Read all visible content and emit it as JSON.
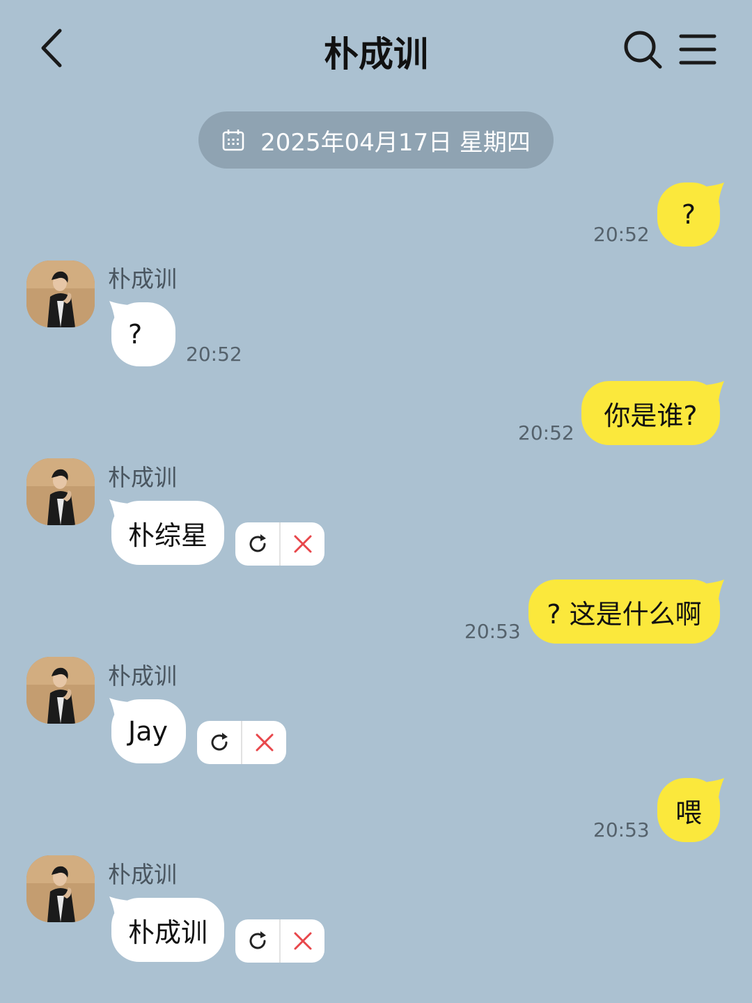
{
  "header": {
    "title": "朴成训",
    "back_icon": "chevron-left-icon",
    "search_icon": "search-icon",
    "menu_icon": "hamburger-menu-icon"
  },
  "date_divider": {
    "icon": "calendar-icon",
    "text": "2025年04月17日 星期四"
  },
  "messages": [
    {
      "direction": "out",
      "text": "?",
      "time": "20:52"
    },
    {
      "direction": "in",
      "sender": "朴成训",
      "text": "?",
      "time": "20:52"
    },
    {
      "direction": "out",
      "text": "你是谁?",
      "time": "20:52"
    },
    {
      "direction": "in",
      "sender": "朴成训",
      "text": "朴综星",
      "failed": true
    },
    {
      "direction": "out",
      "text": "? 这是什么啊",
      "time": "20:53"
    },
    {
      "direction": "in",
      "sender": "朴成训",
      "text": "Jay",
      "failed": true
    },
    {
      "direction": "out",
      "text": "喂",
      "time": "20:53"
    },
    {
      "direction": "in",
      "sender": "朴成训",
      "text": "朴成训",
      "failed": true
    }
  ],
  "colors": {
    "background": "#abc1d1",
    "outgoing_bubble": "#fbe83c",
    "incoming_bubble": "#ffffff",
    "date_pill": "#8fa3b2",
    "delete_icon": "#e8474b"
  },
  "action_icons": {
    "retry": "retry-icon",
    "delete": "delete-x-icon"
  }
}
